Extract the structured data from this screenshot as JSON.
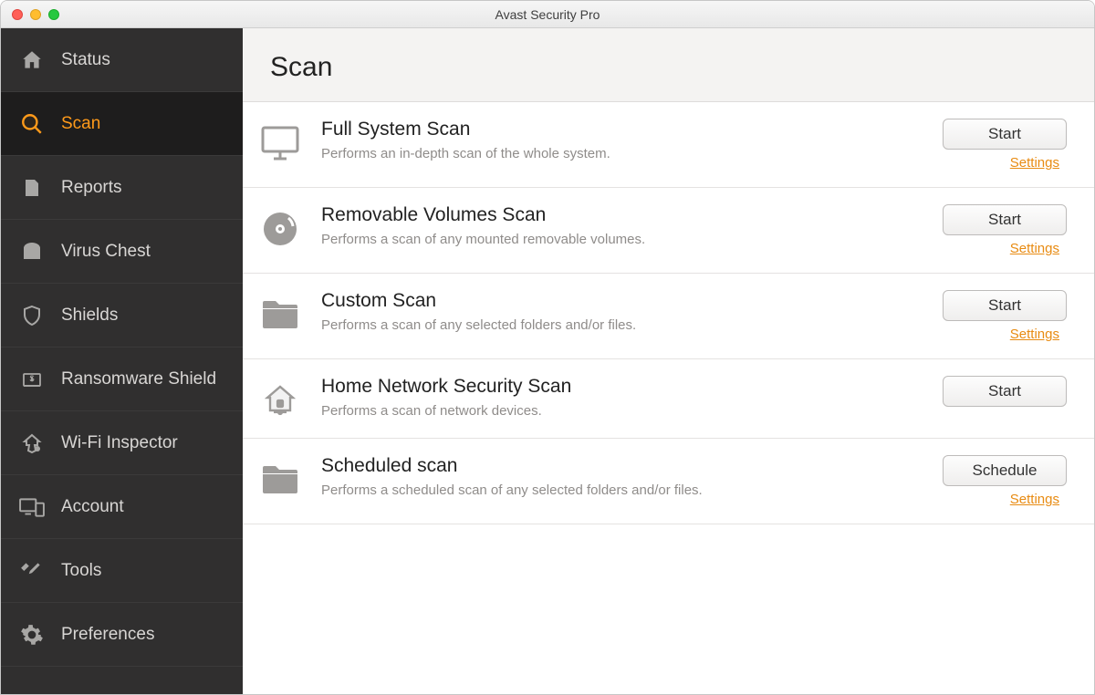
{
  "window_title": "Avast Security Pro",
  "sidebar": {
    "items": [
      {
        "id": "status",
        "label": "Status",
        "icon": "home-icon"
      },
      {
        "id": "scan",
        "label": "Scan",
        "icon": "search-icon",
        "active": true
      },
      {
        "id": "reports",
        "label": "Reports",
        "icon": "document-icon"
      },
      {
        "id": "virus-chest",
        "label": "Virus Chest",
        "icon": "chest-icon"
      },
      {
        "id": "shields",
        "label": "Shields",
        "icon": "shield-icon"
      },
      {
        "id": "ransomware-shield",
        "label": "Ransomware Shield",
        "icon": "ransomware-icon"
      },
      {
        "id": "wifi-inspector",
        "label": "Wi-Fi Inspector",
        "icon": "wifi-icon"
      },
      {
        "id": "account",
        "label": "Account",
        "icon": "devices-icon"
      },
      {
        "id": "tools",
        "label": "Tools",
        "icon": "tools-icon"
      },
      {
        "id": "preferences",
        "label": "Preferences",
        "icon": "gear-icon"
      }
    ]
  },
  "main": {
    "heading": "Scan",
    "settings_label": "Settings",
    "scans": [
      {
        "id": "full-system",
        "title": "Full System Scan",
        "desc": "Performs an in-depth scan of the whole system.",
        "button": "Start",
        "has_settings": true,
        "icon": "monitor-icon"
      },
      {
        "id": "removable-volumes",
        "title": "Removable Volumes Scan",
        "desc": "Performs a scan of any mounted removable volumes.",
        "button": "Start",
        "has_settings": true,
        "icon": "disc-icon"
      },
      {
        "id": "custom",
        "title": "Custom Scan",
        "desc": "Performs a scan of any selected folders and/or files.",
        "button": "Start",
        "has_settings": true,
        "icon": "folder-icon"
      },
      {
        "id": "home-network",
        "title": "Home Network Security Scan",
        "desc": "Performs a scan of network devices.",
        "button": "Start",
        "has_settings": false,
        "icon": "house-network-icon"
      },
      {
        "id": "scheduled",
        "title": "Scheduled scan",
        "desc": "Performs a scheduled scan of any selected folders and/or files.",
        "button": "Schedule",
        "has_settings": true,
        "icon": "folder-icon"
      }
    ]
  },
  "colors": {
    "accent": "#ff9a1a",
    "link": "#e88b12",
    "sidebar_bg": "#302f2f"
  }
}
